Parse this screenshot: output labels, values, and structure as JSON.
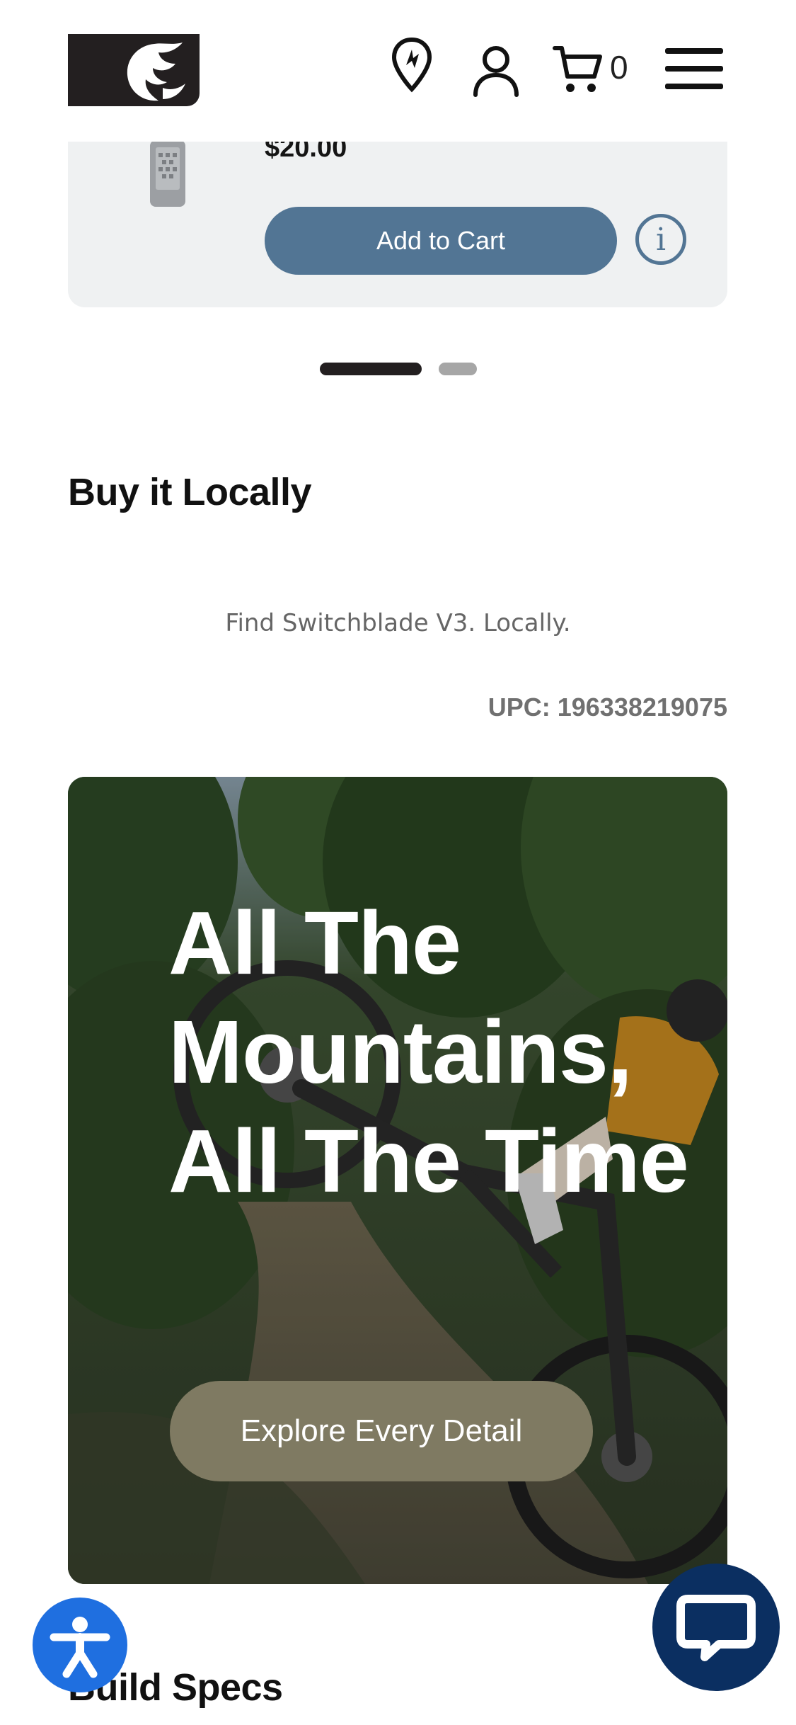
{
  "header": {
    "logo_icon": "phoenix-logo-icon",
    "icons": [
      "location-pin-icon",
      "account-icon",
      "cart-icon",
      "hamburger-menu-icon"
    ],
    "cart_count": "0"
  },
  "product": {
    "price": "$20.00",
    "add_to_cart_label": "Add to Cart",
    "info_label": "i"
  },
  "carousel": {
    "pages": 2,
    "active_page": 1
  },
  "buy_locally": {
    "title": "Buy it Locally",
    "find_text": "Find Switchblade V3. Locally.",
    "upc": "UPC: 196338219075"
  },
  "hero": {
    "title": "All The Mountains, All The Time",
    "cta_label": "Explore Every Detail"
  },
  "build_specs": {
    "title": "Build Specs"
  },
  "colors": {
    "primary_button": "#527594",
    "hero_cta": "#7f7a62",
    "accessibility": "#1f6fe0",
    "chat": "#0b2f61"
  }
}
